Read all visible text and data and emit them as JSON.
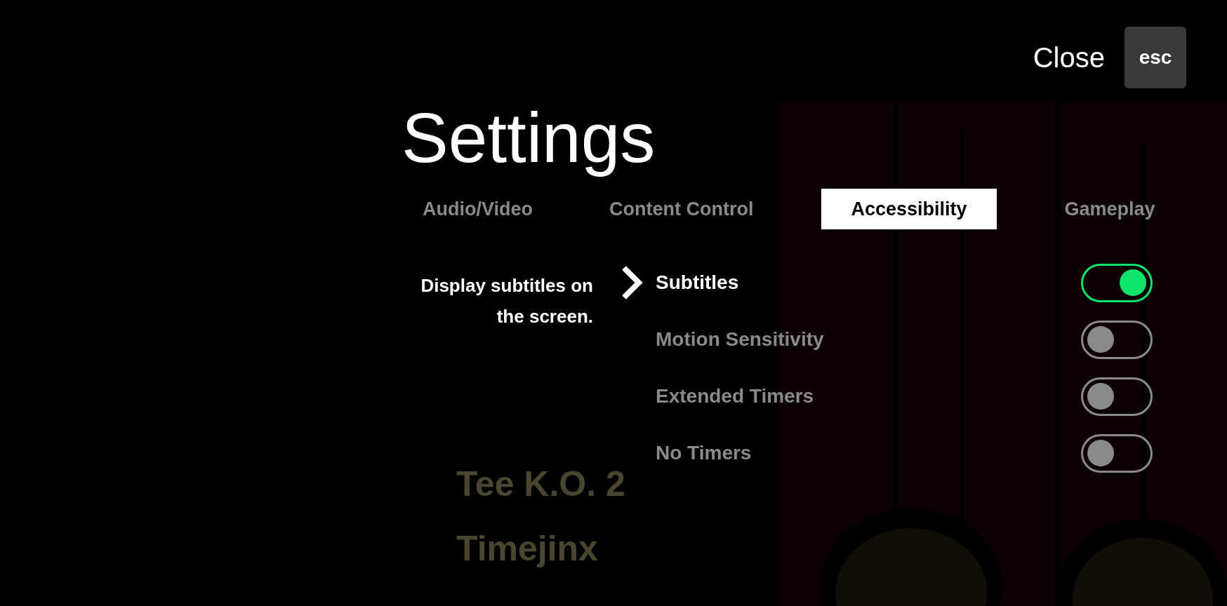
{
  "close": {
    "label": "Close",
    "key": "esc"
  },
  "title": "Settings",
  "tabs": [
    {
      "label": "Audio/Video",
      "selected": false
    },
    {
      "label": "Content Control",
      "selected": false
    },
    {
      "label": "Accessibility",
      "selected": true
    },
    {
      "label": "Gameplay",
      "selected": false
    }
  ],
  "description": "Display subtitles on the screen.",
  "options": [
    {
      "label": "Subtitles",
      "focused": true,
      "on": true
    },
    {
      "label": "Motion Sensitivity",
      "focused": false,
      "on": false
    },
    {
      "label": "Extended Timers",
      "focused": false,
      "on": false
    },
    {
      "label": "No Timers",
      "focused": false,
      "on": false
    }
  ],
  "background_menu": [
    "Tee K.O. 2",
    "Timejinx"
  ]
}
